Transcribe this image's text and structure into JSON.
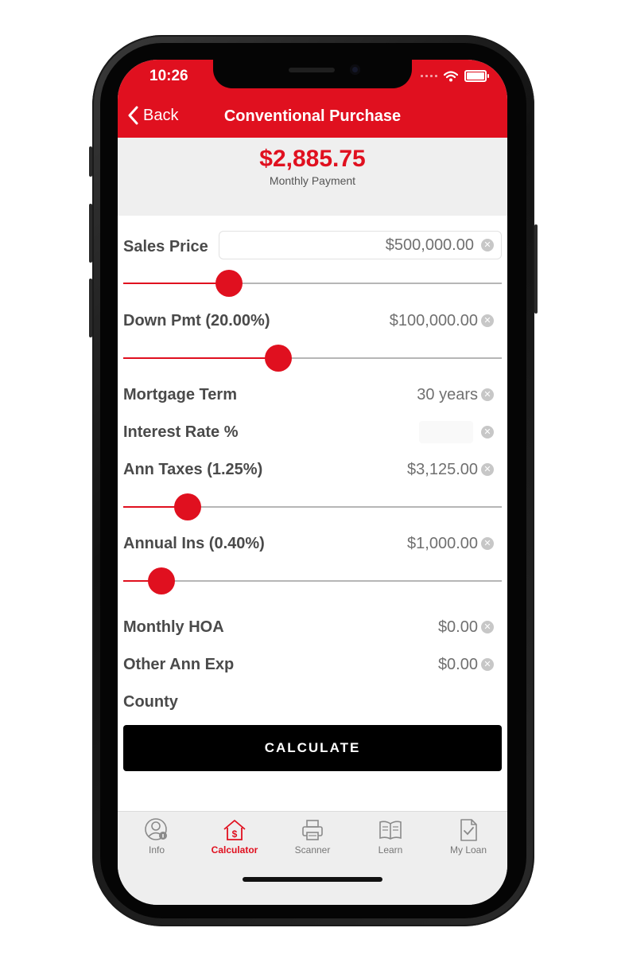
{
  "status_bar": {
    "time": "10:26"
  },
  "nav": {
    "back_label": "Back",
    "title": "Conventional Purchase"
  },
  "summary": {
    "amount": "$2,885.75",
    "label": "Monthly Payment"
  },
  "fields": {
    "sales_price": {
      "label": "Sales Price",
      "value": "$500,000.00",
      "slider_fraction": 0.28
    },
    "down_payment": {
      "label": "Down Pmt (20.00%)",
      "value": "$100,000.00",
      "slider_fraction": 0.41
    },
    "mortgage_term": {
      "label": "Mortgage Term",
      "value": "30 years"
    },
    "interest_rate": {
      "label": "Interest Rate %",
      "value": ""
    },
    "annual_taxes": {
      "label": "Ann Taxes (1.25%)",
      "value": "$3,125.00",
      "slider_fraction": 0.17
    },
    "annual_insurance": {
      "label": "Annual Ins (0.40%)",
      "value": "$1,000.00",
      "slider_fraction": 0.1
    },
    "monthly_hoa": {
      "label": "Monthly HOA",
      "value": "$0.00"
    },
    "other_annual_expenses": {
      "label": "Other Ann Exp",
      "value": "$0.00"
    },
    "county": {
      "label": "County",
      "value": ""
    }
  },
  "calculate_button": {
    "label": "CALCULATE"
  },
  "tabs": [
    {
      "label": "Info",
      "icon": "person-info-icon",
      "active": false
    },
    {
      "label": "Calculator",
      "icon": "house-dollar-icon",
      "active": true
    },
    {
      "label": "Scanner",
      "icon": "scanner-icon",
      "active": false
    },
    {
      "label": "Learn",
      "icon": "book-icon",
      "active": false
    },
    {
      "label": "My Loan",
      "icon": "document-check-icon",
      "active": false
    }
  ],
  "colors": {
    "accent": "#e0101f",
    "button": "#000000",
    "tabbar": "#eeeeee"
  }
}
